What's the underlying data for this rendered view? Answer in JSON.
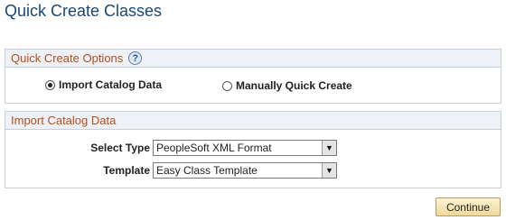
{
  "page": {
    "title": "Quick Create Classes"
  },
  "quick_create_options": {
    "header": "Quick Create Options",
    "help_icon": "help-question-icon",
    "help_glyph": "?",
    "radios": [
      {
        "label": "Import Catalog Data",
        "checked": true
      },
      {
        "label": "Manually Quick Create",
        "checked": false
      }
    ]
  },
  "import_catalog_data": {
    "header": "Import Catalog Data",
    "select_type": {
      "label": "Select Type",
      "value": "PeopleSoft XML Format"
    },
    "template": {
      "label": "Template",
      "value": "Easy Class Template"
    }
  },
  "buttons": {
    "continue_label": "Continue"
  }
}
